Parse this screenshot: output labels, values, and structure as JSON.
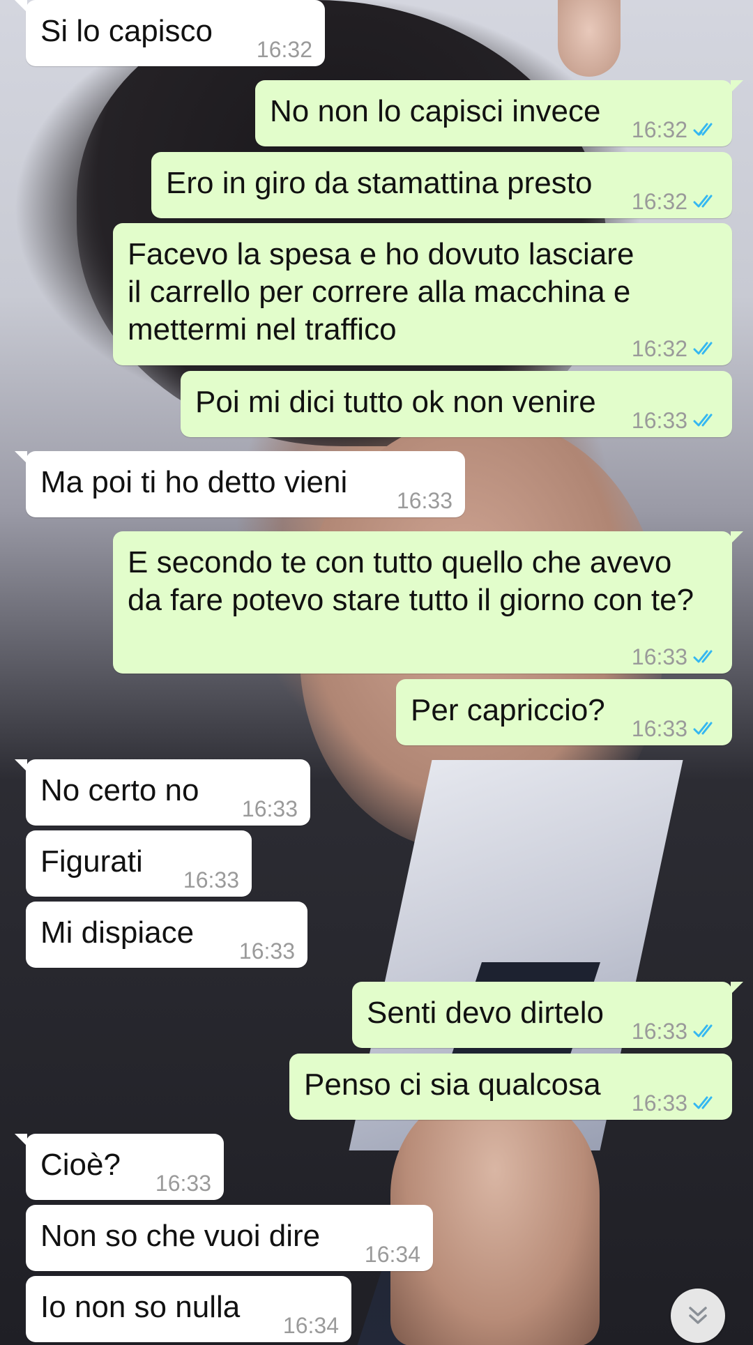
{
  "colors": {
    "incoming_bubble": "#ffffff",
    "outgoing_bubble": "#e2fdcb",
    "timestamp": "#9a9a9a",
    "read_ticks": "#34b7f1"
  },
  "wallpaper": "photo-portrait-man-in-suit",
  "messages": [
    {
      "direction": "in",
      "text": "Si lo capisco",
      "time": "16:32"
    },
    {
      "direction": "out",
      "text": "No non lo capisci invece",
      "time": "16:32",
      "status": "read"
    },
    {
      "direction": "out",
      "text": "Ero in giro da stamattina presto",
      "time": "16:32",
      "status": "read"
    },
    {
      "direction": "out",
      "text": "Facevo la spesa e ho dovuto lasciare\nil carrello per correre alla macchina e\nmettermi nel traffico",
      "time": "16:32",
      "status": "read"
    },
    {
      "direction": "out",
      "text": "Poi mi dici tutto ok non venire",
      "time": "16:33",
      "status": "read"
    },
    {
      "direction": "in",
      "text": "Ma poi ti ho detto vieni",
      "time": "16:33"
    },
    {
      "direction": "out",
      "text": "E secondo te con tutto quello che avevo\nda fare potevo stare tutto il giorno con te?",
      "time": "16:33",
      "status": "read"
    },
    {
      "direction": "out",
      "text": "Per capriccio?",
      "time": "16:33",
      "status": "read"
    },
    {
      "direction": "in",
      "text": "No certo no",
      "time": "16:33"
    },
    {
      "direction": "in",
      "text": "Figurati",
      "time": "16:33"
    },
    {
      "direction": "in",
      "text": "Mi dispiace",
      "time": "16:33"
    },
    {
      "direction": "out",
      "text": "Senti devo dirtelo",
      "time": "16:33",
      "status": "read"
    },
    {
      "direction": "out",
      "text": "Penso ci sia qualcosa",
      "time": "16:33",
      "status": "read"
    },
    {
      "direction": "in",
      "text": "Cioè?",
      "time": "16:33"
    },
    {
      "direction": "in",
      "text": "Non so che vuoi dire",
      "time": "16:34"
    },
    {
      "direction": "in",
      "text": "Io non so nulla",
      "time": "16:34"
    }
  ],
  "scroll_button": {
    "icon": "double-chevron-down-icon"
  }
}
